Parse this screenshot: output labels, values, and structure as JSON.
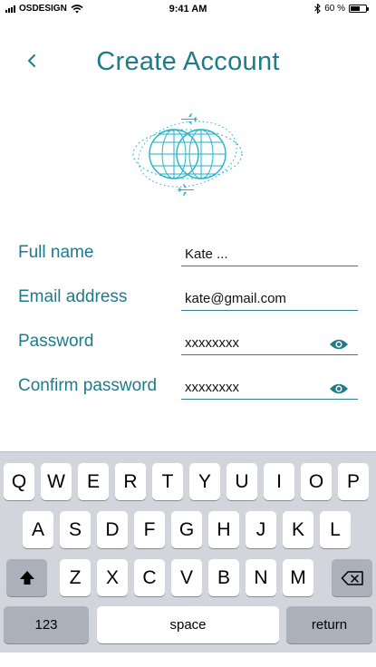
{
  "status_bar": {
    "carrier": "OSDESIGN",
    "time": "9:41 AM",
    "battery_text": "60 %",
    "battery_level": 0.6
  },
  "header": {
    "title": "Create Account",
    "back_icon": "chevron-left-icon"
  },
  "logo": {
    "icon": "globe-with-planes-logo"
  },
  "form": {
    "fields": [
      {
        "label": "Full name",
        "value": "Kate ..."
      },
      {
        "label": "Email address",
        "value": "kate@gmail.com"
      },
      {
        "label": "Password",
        "value": "xxxxxxxx",
        "icon": "eye-icon"
      },
      {
        "label": "Confirm password",
        "value": "xxxxxxxx",
        "icon": "eye-icon"
      }
    ]
  },
  "keyboard": {
    "row1": [
      "Q",
      "W",
      "E",
      "R",
      "T",
      "Y",
      "U",
      "I",
      "O",
      "P"
    ],
    "row2": [
      "A",
      "S",
      "D",
      "F",
      "G",
      "H",
      "J",
      "K",
      "L"
    ],
    "row3": [
      "Z",
      "X",
      "C",
      "V",
      "B",
      "N",
      "M"
    ],
    "numbers_label": "123",
    "space_label": "space",
    "return_label": "return"
  },
  "colors": {
    "accent": "#1f7a8a",
    "logo": "#22b3c9",
    "keyboard_bg": "#d2d5db"
  }
}
